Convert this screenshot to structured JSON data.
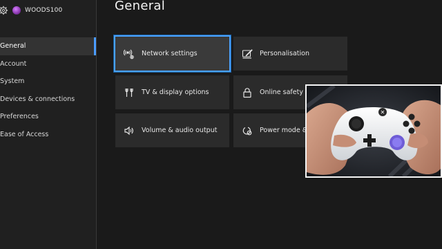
{
  "profile": {
    "gamertag": "WOODS100"
  },
  "header": {
    "title": "General"
  },
  "sidebar": {
    "items": [
      {
        "label": "General",
        "selected": true
      },
      {
        "label": "Account"
      },
      {
        "label": "System"
      },
      {
        "label": "Devices & connections"
      },
      {
        "label": "Preferences"
      },
      {
        "label": "Ease of Access"
      }
    ]
  },
  "tiles": {
    "network": {
      "label": "Network settings",
      "icon": "network-icon"
    },
    "personalisation": {
      "label": "Personalisation",
      "icon": "paintbrush-icon"
    },
    "tv": {
      "label": "TV & display options",
      "icon": "tv-icon"
    },
    "online_safety": {
      "label": "Online safety &",
      "icon": "lock-icon"
    },
    "volume": {
      "label": "Volume & audio output",
      "icon": "speaker-icon"
    },
    "power": {
      "label": "Power mode &",
      "icon": "power-leaf-icon"
    }
  },
  "colors": {
    "accent": "#4aa3ff",
    "background": "#1a1a1a",
    "tile": "#2b2b2b"
  }
}
